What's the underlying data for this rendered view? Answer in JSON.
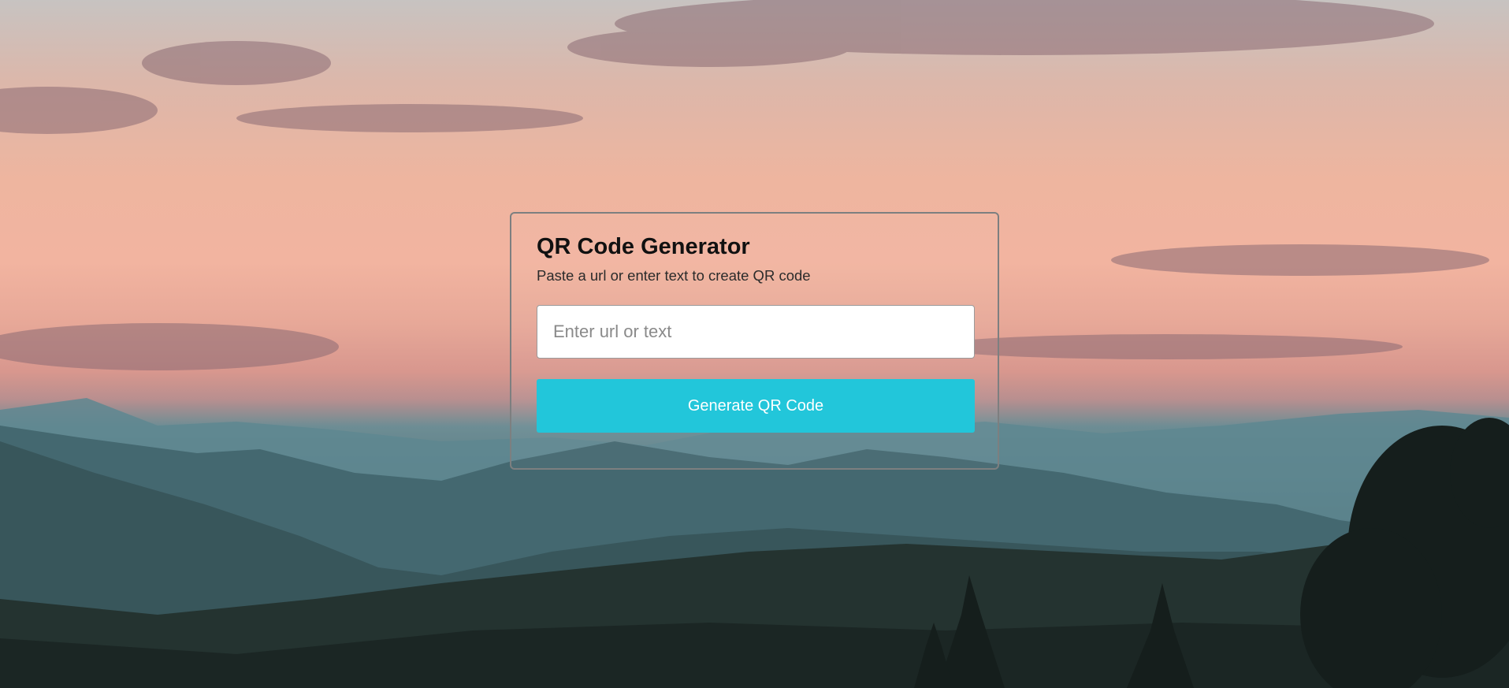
{
  "card": {
    "title": "QR Code Generator",
    "subtitle": "Paste a url or enter text to create QR code",
    "input_placeholder": "Enter url or text",
    "input_value": "",
    "button_label": "Generate QR Code"
  },
  "colors": {
    "button_bg": "#22c6da",
    "button_text": "#ffffff",
    "card_border": "#7d7f80",
    "title_text": "#111111"
  }
}
